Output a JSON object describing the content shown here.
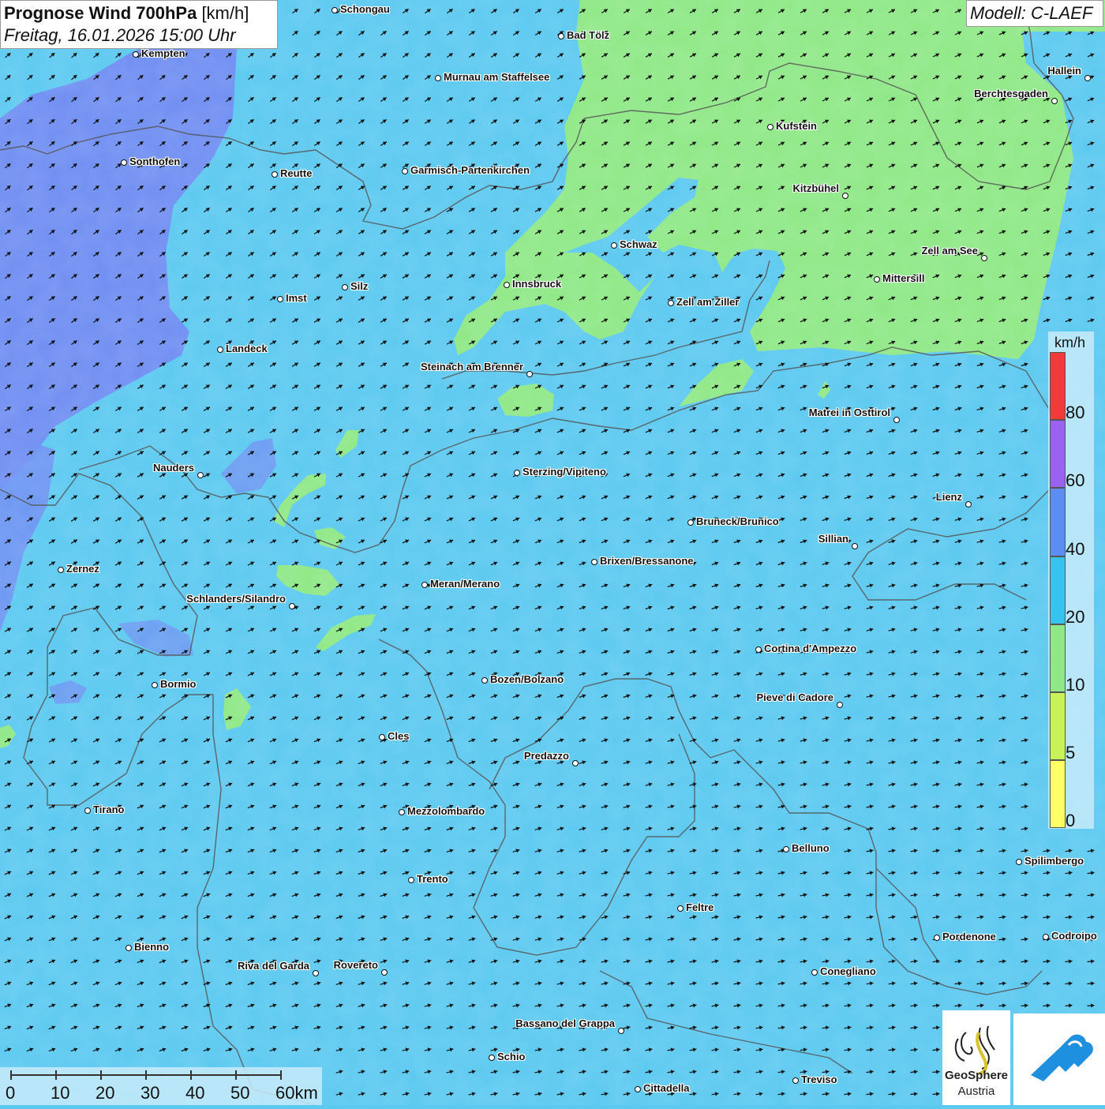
{
  "header": {
    "title_bold": "Prognose Wind 700hPa",
    "title_unit": "[km/h]",
    "subtitle": "Freitag, 16.01.2026 15:00 Uhr",
    "model": "Modell: C-LAEF"
  },
  "colors": {
    "wind_20_40": "#5cc9f0",
    "wind_10_20": "#8fe886",
    "wind_40_60": "#6f8ef2",
    "borders": "#555555",
    "arrows": "#111111"
  },
  "wind_field": {
    "direction": "from south-west towards north-east",
    "arrow_icon": "wind-arrow-icon"
  },
  "cities": [
    {
      "name": "Schongau"
    },
    {
      "name": "Bad Tölz"
    },
    {
      "name": "Kempten"
    },
    {
      "name": "Murnau am Staffelsee"
    },
    {
      "name": "Hallein"
    },
    {
      "name": "Berchtesgaden"
    },
    {
      "name": "Kufstein"
    },
    {
      "name": "Sonthofen"
    },
    {
      "name": "Reutte"
    },
    {
      "name": "Garmisch-Partenkirchen"
    },
    {
      "name": "Kitzbühel"
    },
    {
      "name": "Schwaz"
    },
    {
      "name": "Zell am See"
    },
    {
      "name": "Innsbruck"
    },
    {
      "name": "Mittersill"
    },
    {
      "name": "Imst"
    },
    {
      "name": "Silz"
    },
    {
      "name": "Zell am Ziller"
    },
    {
      "name": "Landeck"
    },
    {
      "name": "Steinach am Brenner"
    },
    {
      "name": "Matrei in Osttirol"
    },
    {
      "name": "Nauders"
    },
    {
      "name": "Sterzing/Vipiteno"
    },
    {
      "name": "Lienz"
    },
    {
      "name": "Bruneck/Brunico"
    },
    {
      "name": "Sillian"
    },
    {
      "name": "Brixen/Bressanone"
    },
    {
      "name": "Zernez"
    },
    {
      "name": "Meran/Merano"
    },
    {
      "name": "Schlanders/Silandro"
    },
    {
      "name": "Cortina d'Ampezzo"
    },
    {
      "name": "Bozen/Bolzano"
    },
    {
      "name": "Bormio"
    },
    {
      "name": "Pieve di Cadore"
    },
    {
      "name": "Cles"
    },
    {
      "name": "Predazzo"
    },
    {
      "name": "Tirano"
    },
    {
      "name": "Mezzolombardo"
    },
    {
      "name": "Belluno"
    },
    {
      "name": "Spilimbergo"
    },
    {
      "name": "Trento"
    },
    {
      "name": "Feltre"
    },
    {
      "name": "Pordenone"
    },
    {
      "name": "Codroipo"
    },
    {
      "name": "Bienno"
    },
    {
      "name": "Riva del Garda"
    },
    {
      "name": "Rovereto"
    },
    {
      "name": "Conegliano"
    },
    {
      "name": "Bassano del Grappa"
    },
    {
      "name": "Schio"
    },
    {
      "name": "Treviso"
    },
    {
      "name": "Cittadella"
    }
  ],
  "legend": {
    "unit": "km/h",
    "bins": [
      {
        "color": "#ffff66"
      },
      {
        "color": "#c8f25a"
      },
      {
        "color": "#8fe886"
      },
      {
        "color": "#36c3f0"
      },
      {
        "color": "#5b8ef2"
      },
      {
        "color": "#9a62f0"
      },
      {
        "color": "#f23a3a"
      }
    ],
    "labels": [
      "0",
      "5",
      "10",
      "20",
      "40",
      "60",
      "80"
    ]
  },
  "scalebar": {
    "labels": [
      "0",
      "10",
      "20",
      "30",
      "40",
      "50",
      "60km"
    ]
  },
  "logo": {
    "name_line1": "GeoSphere",
    "name_line2": "Austria"
  }
}
